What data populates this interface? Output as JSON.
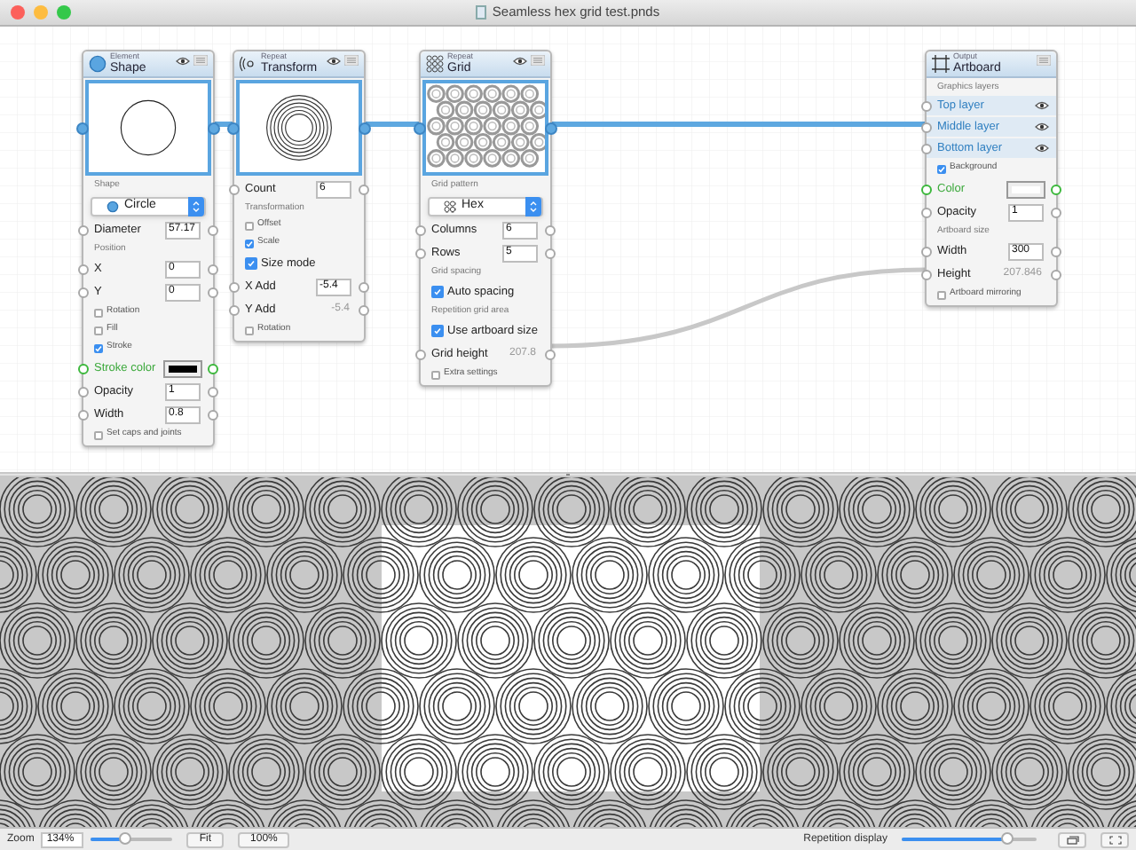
{
  "window": {
    "title": "Seamless hex grid test.pnds"
  },
  "nodes": [
    {
      "category": "Element",
      "title": "Shape",
      "eye": true,
      "rows": [
        {
          "kind": "section",
          "label": "Shape"
        },
        {
          "kind": "dropdown",
          "value": "Circle"
        },
        {
          "kind": "field",
          "label": "Diameter",
          "value": "57.17",
          "disabled": false
        },
        {
          "kind": "section",
          "label": "Position"
        },
        {
          "kind": "field",
          "label": "X",
          "value": "0",
          "disabled": false
        },
        {
          "kind": "field",
          "label": "Y",
          "value": "0",
          "disabled": false
        },
        {
          "kind": "check",
          "label": "Rotation",
          "checked": false
        },
        {
          "kind": "check",
          "label": "Fill",
          "checked": false
        },
        {
          "kind": "check",
          "label": "Stroke",
          "checked": true
        },
        {
          "kind": "color",
          "label": "Stroke color",
          "color": "#000000"
        },
        {
          "kind": "field",
          "label": "Opacity",
          "value": "1",
          "disabled": false
        },
        {
          "kind": "field",
          "label": "Width",
          "value": "0.8",
          "disabled": false
        },
        {
          "kind": "check",
          "label": "Set caps and joints",
          "checked": false
        }
      ]
    },
    {
      "category": "Repeat",
      "title": "Transform",
      "eye": true,
      "rows": [
        {
          "kind": "field",
          "label": "Count",
          "value": "6",
          "disabled": false
        },
        {
          "kind": "section",
          "label": "Transformation"
        },
        {
          "kind": "check",
          "label": "Offset",
          "checked": false
        },
        {
          "kind": "check",
          "label": "Scale",
          "checked": true
        },
        {
          "kind": "bigcheck",
          "label": "Size mode",
          "checked": true
        },
        {
          "kind": "field",
          "label": "X Add",
          "value": "-5.4",
          "disabled": false
        },
        {
          "kind": "field",
          "label": "Y Add",
          "value": "-5.4",
          "disabled": true
        },
        {
          "kind": "check",
          "label": "Rotation",
          "checked": false
        }
      ]
    },
    {
      "category": "Repeat",
      "title": "Grid",
      "eye": true,
      "rows": [
        {
          "kind": "section",
          "label": "Grid pattern"
        },
        {
          "kind": "dropdown",
          "value": "Hex"
        },
        {
          "kind": "field",
          "label": "Columns",
          "value": "6",
          "disabled": false
        },
        {
          "kind": "field",
          "label": "Rows",
          "value": "5",
          "disabled": false
        },
        {
          "kind": "section",
          "label": "Grid spacing"
        },
        {
          "kind": "bigcheck",
          "label": "Auto spacing",
          "checked": true
        },
        {
          "kind": "section",
          "label": "Repetition grid area"
        },
        {
          "kind": "bigcheck",
          "label": "Use artboard size",
          "checked": true
        },
        {
          "kind": "field",
          "label": "Grid height",
          "value": "207.8",
          "disabled": true
        },
        {
          "kind": "check",
          "label": "Extra settings",
          "checked": false
        }
      ]
    },
    {
      "category": "Output",
      "title": "Artboard",
      "eye": false,
      "rows": [
        {
          "kind": "section",
          "label": "Graphics layers"
        },
        {
          "kind": "layer",
          "label": "Top layer"
        },
        {
          "kind": "layer",
          "label": "Middle layer"
        },
        {
          "kind": "layer",
          "label": "Bottom layer"
        },
        {
          "kind": "check",
          "label": "Background",
          "checked": true
        },
        {
          "kind": "color",
          "label": "Color",
          "color": "#ffffff"
        },
        {
          "kind": "field",
          "label": "Opacity",
          "value": "1",
          "disabled": false
        },
        {
          "kind": "section",
          "label": "Artboard size"
        },
        {
          "kind": "field",
          "label": "Width",
          "value": "300",
          "disabled": false
        },
        {
          "kind": "field",
          "label": "Height",
          "value": "207.846",
          "disabled": true
        },
        {
          "kind": "check",
          "label": "Artboard mirroring",
          "checked": false
        }
      ]
    }
  ],
  "status_bar": {
    "zoom_label": "Zoom",
    "zoom_value": "134%",
    "zoom_slider": {
      "level": 0.42
    },
    "buttons": [
      "Fit",
      "100%"
    ],
    "repetition_label": "Repetition display",
    "repetition_slider": {
      "level": 0.78
    }
  }
}
